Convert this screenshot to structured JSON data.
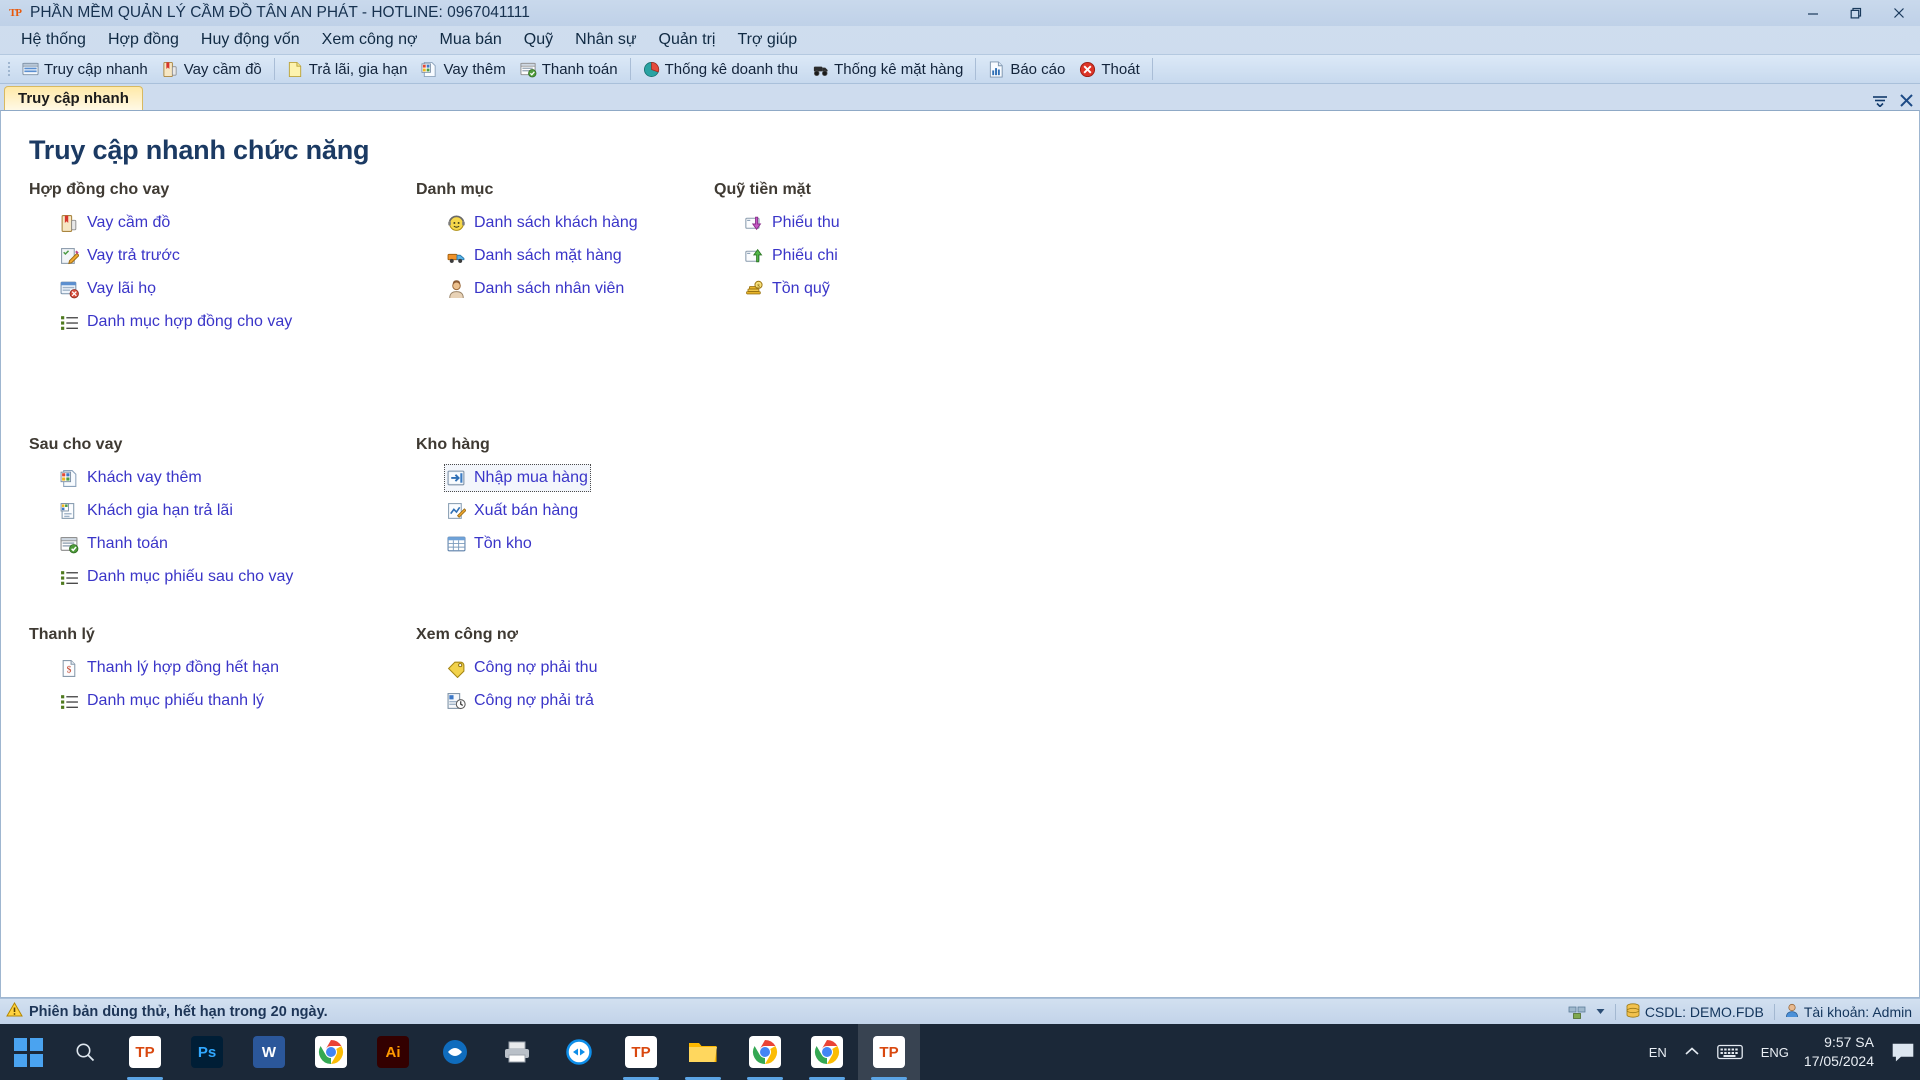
{
  "window": {
    "title": "PHẦN MỀM QUẢN LÝ CẦM ĐỒ TÂN AN PHÁT - HOTLINE: 0967041111",
    "logo_text": "TP",
    "minimize_label": "Thu nhỏ",
    "maximize_label": "Phóng to",
    "close_label": "Đóng"
  },
  "menubar": {
    "items": [
      {
        "label": "Hệ thống"
      },
      {
        "label": "Hợp đồng"
      },
      {
        "label": "Huy động vốn"
      },
      {
        "label": "Xem công nợ"
      },
      {
        "label": "Mua bán"
      },
      {
        "label": "Quỹ"
      },
      {
        "label": "Nhân sự"
      },
      {
        "label": "Quản trị"
      },
      {
        "label": "Trợ giúp"
      }
    ]
  },
  "toolbar": {
    "groups": [
      {
        "items": [
          {
            "label": "Truy cập nhanh",
            "icon": "quick-access-icon"
          },
          {
            "label": "Vay cầm đồ",
            "icon": "pawn-loan-icon"
          }
        ]
      },
      {
        "items": [
          {
            "label": "Trả lãi, gia hạn",
            "icon": "interest-payment-icon"
          },
          {
            "label": "Vay thêm",
            "icon": "extra-loan-icon"
          },
          {
            "label": "Thanh toán",
            "icon": "payment-icon"
          }
        ]
      },
      {
        "items": [
          {
            "label": "Thống kê doanh thu",
            "icon": "revenue-chart-icon"
          },
          {
            "label": "Thống kê mặt hàng",
            "icon": "goods-stats-icon"
          }
        ]
      },
      {
        "items": [
          {
            "label": "Báo cáo",
            "icon": "report-icon"
          },
          {
            "label": "Thoát",
            "icon": "exit-icon"
          }
        ]
      }
    ]
  },
  "tabs": {
    "items": [
      {
        "label": "Truy cập nhanh",
        "active": true
      }
    ],
    "dropdown_label": "Danh sách cửa sổ",
    "close_label": "Đóng cửa sổ"
  },
  "page": {
    "title": "Truy cập nhanh chức năng",
    "columns": [
      {
        "name": "column-1",
        "groups": [
          {
            "title": "Hợp đồng cho vay",
            "links": [
              {
                "label": "Vay cầm đồ",
                "icon": "pawn-loan-icon"
              },
              {
                "label": "Vay trả trước",
                "icon": "prepaid-loan-icon"
              },
              {
                "label": "Vay lãi họ",
                "icon": "interest-loan-icon"
              },
              {
                "label": "Danh mục hợp đồng cho vay",
                "icon": "list-icon"
              }
            ]
          },
          {
            "title": "Sau cho vay",
            "links": [
              {
                "label": "Khách vay thêm",
                "icon": "extra-loan-icon"
              },
              {
                "label": "Khách gia hạn trả lãi",
                "icon": "extend-interest-icon"
              },
              {
                "label": "Thanh toán",
                "icon": "payment-icon"
              },
              {
                "label": "Danh mục phiếu sau cho vay",
                "icon": "list-icon"
              }
            ]
          },
          {
            "title": "Thanh lý",
            "links": [
              {
                "label": "Thanh lý hợp đồng hết hạn",
                "icon": "liquidate-icon"
              },
              {
                "label": "Danh mục phiếu thanh lý",
                "icon": "list-icon"
              }
            ]
          }
        ]
      },
      {
        "name": "column-2",
        "groups": [
          {
            "title": "Danh mục",
            "links": [
              {
                "label": "Danh sách khách hàng",
                "icon": "customer-icon"
              },
              {
                "label": "Danh sách mặt hàng",
                "icon": "goods-icon"
              },
              {
                "label": "Danh sách nhân viên",
                "icon": "employee-icon"
              }
            ]
          },
          {
            "title": "Kho hàng",
            "links": [
              {
                "label": "Nhập mua hàng",
                "icon": "import-goods-icon",
                "focused": true
              },
              {
                "label": "Xuất bán hàng",
                "icon": "export-goods-icon"
              },
              {
                "label": "Tồn kho",
                "icon": "inventory-icon"
              }
            ]
          },
          {
            "title": "Xem công nợ",
            "links": [
              {
                "label": "Công nợ phải thu",
                "icon": "receivable-icon"
              },
              {
                "label": "Công nợ phải trả",
                "icon": "payable-icon"
              }
            ]
          }
        ]
      },
      {
        "name": "column-3",
        "groups": [
          {
            "title": "Quỹ tiền mặt",
            "links": [
              {
                "label": "Phiếu thu",
                "icon": "receipt-in-icon"
              },
              {
                "label": "Phiếu chi",
                "icon": "receipt-out-icon"
              },
              {
                "label": "Tồn quỹ",
                "icon": "cash-balance-icon"
              }
            ]
          }
        ]
      }
    ]
  },
  "statusbar": {
    "warning": "Phiên bản dùng thử, hết hạn trong 20 ngày.",
    "database": "CSDL: DEMO.FDB",
    "account": "Tài khoản: Admin"
  },
  "taskbar": {
    "start_label": "Bắt đầu",
    "search_label": "Tìm kiếm",
    "apps": [
      {
        "name": "tan-an-phat-1",
        "short": "TP",
        "color": "#ffffff",
        "text_color": "#d9480f",
        "running": true
      },
      {
        "name": "photoshop",
        "short": "Ps",
        "color": "#001e36",
        "text_color": "#31a8ff",
        "running": false
      },
      {
        "name": "word",
        "short": "W",
        "color": "#2b579a",
        "text_color": "#ffffff",
        "running": false
      },
      {
        "name": "chrome-1",
        "short": "",
        "color": "#ffffff",
        "text_color": "#4285f4",
        "running": false
      },
      {
        "name": "illustrator",
        "short": "Ai",
        "color": "#330000",
        "text_color": "#ff9a00",
        "running": false
      },
      {
        "name": "blue-app",
        "short": "",
        "color": "#1273de",
        "text_color": "#ffffff",
        "running": false
      },
      {
        "name": "printer-app",
        "short": "",
        "color": "#8a9099",
        "text_color": "#ffffff",
        "running": false
      },
      {
        "name": "teamviewer",
        "short": "",
        "color": "#1a9bd7",
        "text_color": "#ffffff",
        "running": false
      },
      {
        "name": "tan-an-phat-2",
        "short": "TP",
        "color": "#ffffff",
        "text_color": "#d9480f",
        "running": true
      },
      {
        "name": "file-explorer",
        "short": "",
        "color": "#ffc83d",
        "text_color": "#ffffff",
        "running": true
      },
      {
        "name": "chrome-2",
        "short": "",
        "color": "#ffffff",
        "text_color": "#4285f4",
        "running": true
      },
      {
        "name": "chrome-3",
        "short": "",
        "color": "#ffffff",
        "text_color": "#4285f4",
        "running": true
      },
      {
        "name": "tan-an-phat-3",
        "short": "TP",
        "color": "#ffffff",
        "text_color": "#d9480f",
        "running": true,
        "active": true
      }
    ],
    "tray": {
      "input_indicator": "EN",
      "language": "ENG",
      "time": "9:57 SA",
      "date": "17/05/2024",
      "show_hidden_label": "Hiện biểu tượng ẩn",
      "keyboard_label": "Bàn phím cảm ứng",
      "notification_label": "Trung tâm hành động"
    }
  }
}
